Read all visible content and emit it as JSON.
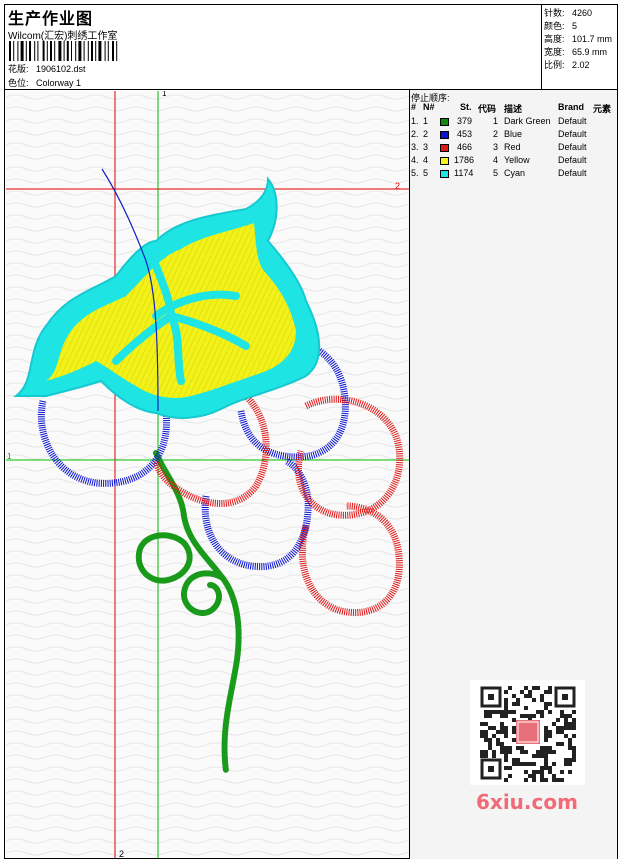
{
  "header": {
    "title": "生产作业图",
    "studio": "Wilcom(汇宏)刺绣工作室",
    "file_label": "花版:",
    "file_value": "1906102.dst",
    "colorway_label": "色位:",
    "colorway_value": "Colorway 1"
  },
  "stats": [
    {
      "label": "针数:",
      "value": "4260"
    },
    {
      "label": "颜色:",
      "value": "5"
    },
    {
      "label": "高度:",
      "value": "101.7 mm"
    },
    {
      "label": "宽度:",
      "value": "65.9 mm"
    },
    {
      "label": "比例:",
      "value": "2.02"
    }
  ],
  "stop_sequence": {
    "title": "停止顺序:",
    "columns": [
      "#",
      "N#",
      "St.",
      "代码",
      "描述",
      "Brand",
      "元素"
    ],
    "rows": [
      {
        "idx": "1.",
        "n": "1",
        "color": "#118a11",
        "stitches": "379",
        "code": "1",
        "desc": "Dark Green",
        "brand": "Default"
      },
      {
        "idx": "2.",
        "n": "2",
        "color": "#0a14d0",
        "stitches": "453",
        "code": "2",
        "desc": "Blue",
        "brand": "Default"
      },
      {
        "idx": "3.",
        "n": "3",
        "color": "#e01818",
        "stitches": "466",
        "code": "3",
        "desc": "Red",
        "brand": "Default"
      },
      {
        "idx": "4.",
        "n": "4",
        "color": "#f4f41a",
        "stitches": "1786",
        "code": "4",
        "desc": "Yellow",
        "brand": "Default"
      },
      {
        "idx": "5.",
        "n": "5",
        "color": "#1ee4e4",
        "stitches": "1174",
        "code": "5",
        "desc": "Cyan",
        "brand": "Default"
      }
    ]
  },
  "guides": {
    "vertical_red_label": "2",
    "vertical_green_label": "1",
    "horizontal_red_label": "2",
    "horizontal_green_label": "1"
  },
  "watermark": "6xiu.com"
}
